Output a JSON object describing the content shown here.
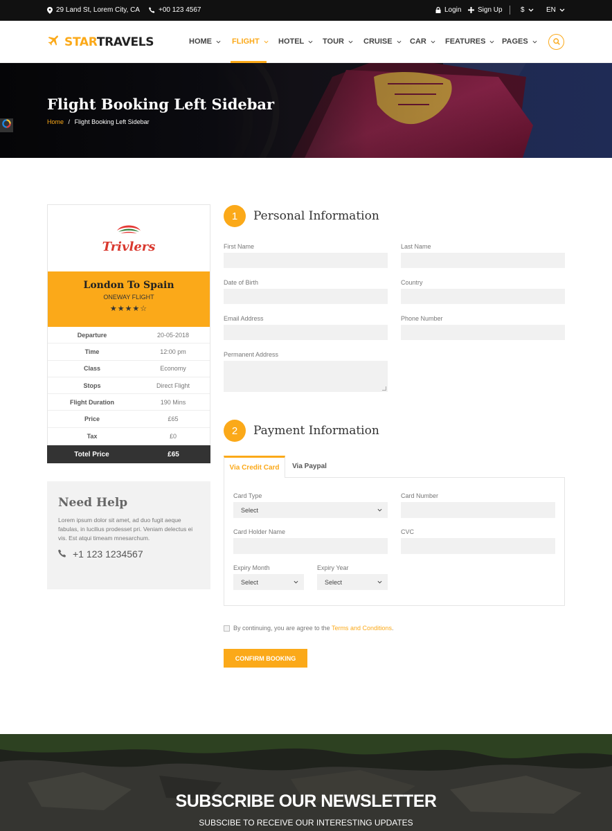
{
  "topbar": {
    "address": "29 Land St, Lorem City, CA",
    "phone": "+00 123 4567",
    "login": "Login",
    "signup": "Sign Up",
    "currency": "$",
    "language": "EN"
  },
  "header": {
    "logo_part1": "STAR",
    "logo_part2": "TRAVELS",
    "nav": [
      {
        "label": "HOME"
      },
      {
        "label": "FLIGHT"
      },
      {
        "label": "HOTEL"
      },
      {
        "label": "TOUR"
      },
      {
        "label": "CRUISE"
      },
      {
        "label": "CAR"
      },
      {
        "label": "FEATURES"
      },
      {
        "label": "PAGES"
      }
    ],
    "active_nav": "FLIGHT"
  },
  "hero": {
    "title": "Flight Booking Left Sidebar",
    "breadcrumb_home": "Home",
    "breadcrumb_sep": "/",
    "breadcrumb_current": "Flight Booking Left Sidebar"
  },
  "sidebar": {
    "brand": "Trivlers",
    "route": "London To Spain",
    "flight_type": "ONEWAY FLIGHT",
    "stars": "★★★★☆",
    "rating": 4,
    "details": [
      {
        "label": "Departure",
        "value": "20-05-2018"
      },
      {
        "label": "Time",
        "value": "12:00 pm"
      },
      {
        "label": "Class",
        "value": "Economy"
      },
      {
        "label": "Stops",
        "value": "Direct Flight"
      },
      {
        "label": "Flight Duration",
        "value": "190 Mins"
      },
      {
        "label": "Price",
        "value": "£65"
      },
      {
        "label": "Tax",
        "value": "£0"
      }
    ],
    "total_label": "Totel Price",
    "total_value": "£65"
  },
  "help": {
    "title": "Need Help",
    "text": "Lorem ipsum dolor sit amet, ad duo fugit aeque fabulas, in lucilius prodesset pri. Veniam delectus ei vis. Est atqui timeam mnesarchum.",
    "phone": "+1 123 1234567"
  },
  "personal": {
    "step": "1",
    "title": "Personal Information",
    "first_name": "First Name",
    "last_name": "Last Name",
    "dob": "Date of Birth",
    "country": "Country",
    "email": "Email Address",
    "phone": "Phone Number",
    "address": "Permanent Address"
  },
  "payment": {
    "step": "2",
    "title": "Payment Information",
    "tab_card": "Via Credit Card",
    "tab_paypal": "Via Paypal",
    "card_type": "Card Type",
    "card_type_value": "Select",
    "card_number": "Card Number",
    "holder_name": "Card Holder Name",
    "cvc": "CVC",
    "expiry_month": "Expiry Month",
    "expiry_month_value": "Select",
    "expiry_year": "Expiry Year",
    "expiry_year_value": "Select"
  },
  "agree": {
    "text": "By continuing, you are agree to the",
    "link": "Terms and Conditions",
    "end": "."
  },
  "confirm_label": "CONFIRM BOOKING",
  "newsletter": {
    "title": "SUBSCRIBE OUR NEWSLETTER",
    "subtitle": "SUBSCIBE TO RECEIVE OUR INTERESTING UPDATES"
  },
  "colors": {
    "accent": "#fba919",
    "dark": "#333333"
  }
}
